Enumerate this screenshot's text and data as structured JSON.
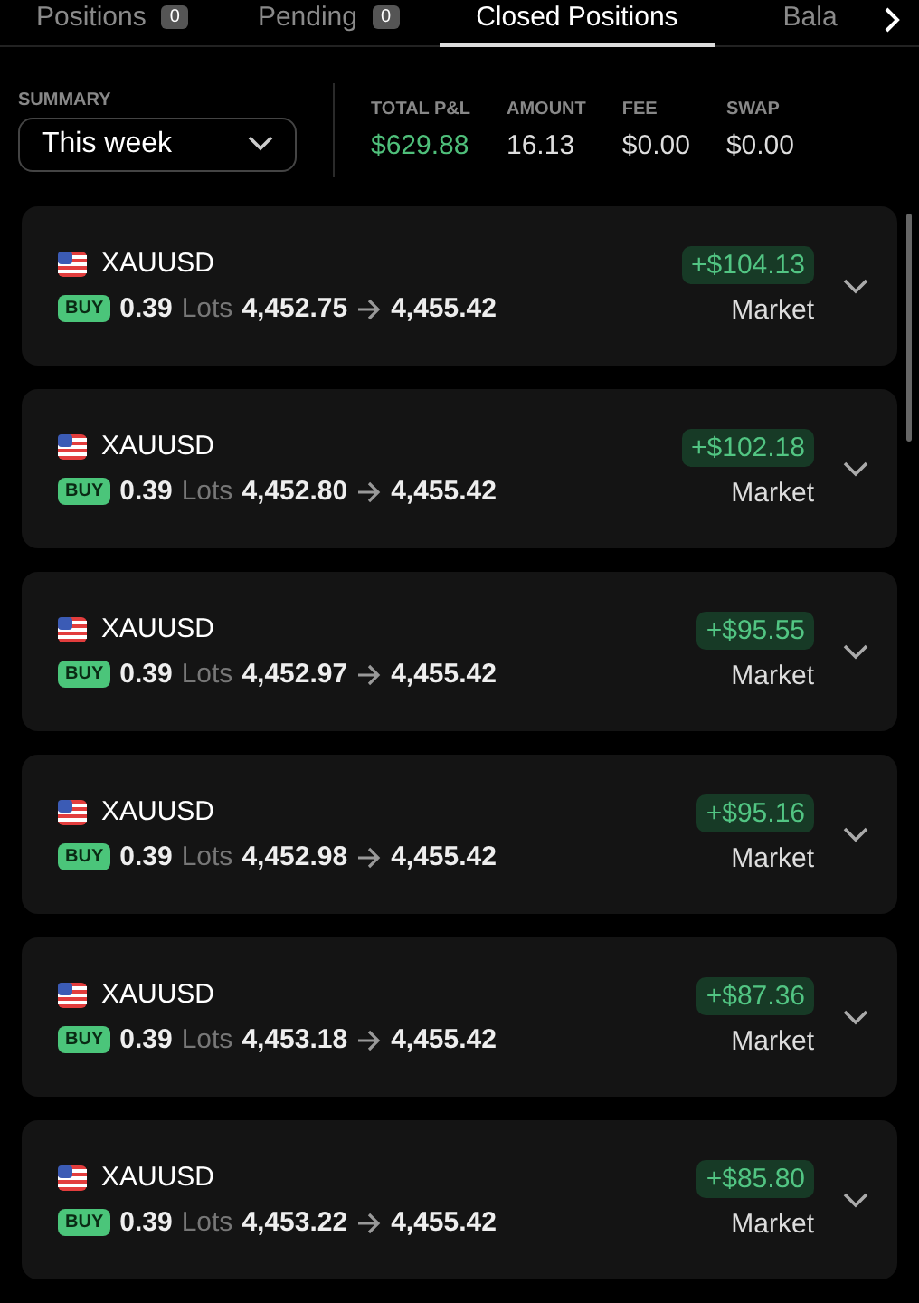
{
  "tabs": [
    {
      "label": "Positions",
      "count": "0",
      "selected": false
    },
    {
      "label": "Pending",
      "count": "0",
      "selected": false
    },
    {
      "label": "Closed Positions",
      "selected": true
    },
    {
      "label": "Bala",
      "selected": false
    }
  ],
  "summary": {
    "label": "SUMMARY",
    "period": "This week",
    "stats": [
      {
        "label": "TOTAL P&L",
        "value": "$629.88",
        "kind": "profit"
      },
      {
        "label": "AMOUNT",
        "value": "16.13",
        "kind": "plain"
      },
      {
        "label": "FEE",
        "value": "$0.00",
        "kind": "plain"
      },
      {
        "label": "SWAP",
        "value": "$0.00",
        "kind": "plain"
      }
    ]
  },
  "positions": [
    {
      "symbol": "XAUUSD",
      "side": "BUY",
      "lots": "0.39",
      "lots_unit": "Lots",
      "open": "4,452.75",
      "close": "4,455.42",
      "pnl": "+$104.13",
      "type": "Market"
    },
    {
      "symbol": "XAUUSD",
      "side": "BUY",
      "lots": "0.39",
      "lots_unit": "Lots",
      "open": "4,452.80",
      "close": "4,455.42",
      "pnl": "+$102.18",
      "type": "Market"
    },
    {
      "symbol": "XAUUSD",
      "side": "BUY",
      "lots": "0.39",
      "lots_unit": "Lots",
      "open": "4,452.97",
      "close": "4,455.42",
      "pnl": "+$95.55",
      "type": "Market"
    },
    {
      "symbol": "XAUUSD",
      "side": "BUY",
      "lots": "0.39",
      "lots_unit": "Lots",
      "open": "4,452.98",
      "close": "4,455.42",
      "pnl": "+$95.16",
      "type": "Market"
    },
    {
      "symbol": "XAUUSD",
      "side": "BUY",
      "lots": "0.39",
      "lots_unit": "Lots",
      "open": "4,453.18",
      "close": "4,455.42",
      "pnl": "+$87.36",
      "type": "Market"
    },
    {
      "symbol": "XAUUSD",
      "side": "BUY",
      "lots": "0.39",
      "lots_unit": "Lots",
      "open": "4,453.22",
      "close": "4,455.42",
      "pnl": "+$85.80",
      "type": "Market"
    }
  ]
}
